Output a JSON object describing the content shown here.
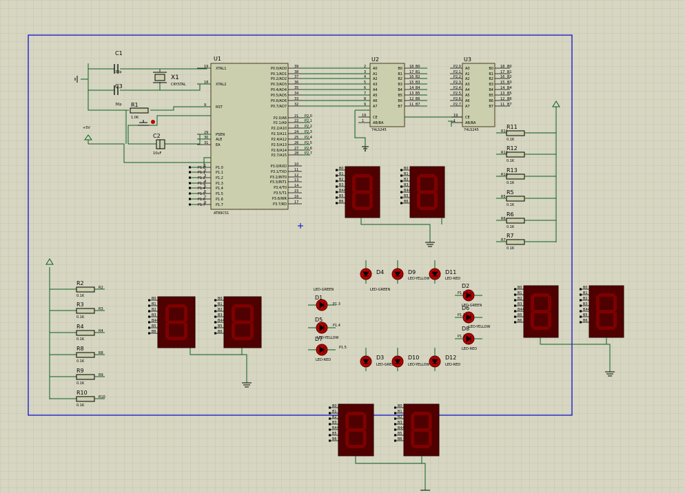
{
  "schematic": {
    "u1": {
      "ref": "U1",
      "part": "AT89C51",
      "left_pins": [
        {
          "num": "19",
          "name": "XTAL1"
        },
        {
          "num": "18",
          "name": "XTAL2"
        },
        {
          "num": "9",
          "name": "RST"
        },
        {
          "num": "29",
          "name": "PSEN"
        },
        {
          "num": "30",
          "name": "ALE"
        },
        {
          "num": "31",
          "name": "EA"
        },
        {
          "num": "1",
          "name": "P1.0"
        },
        {
          "num": "2",
          "name": "P1.1"
        },
        {
          "num": "3",
          "name": "P1.2"
        },
        {
          "num": "4",
          "name": "P1.3"
        },
        {
          "num": "5",
          "name": "P1.4"
        },
        {
          "num": "6",
          "name": "P1.5"
        },
        {
          "num": "7",
          "name": "P1.6"
        },
        {
          "num": "8",
          "name": "P1.7"
        }
      ],
      "right_pins": [
        {
          "num": "39",
          "name": "P0.0/AD0"
        },
        {
          "num": "38",
          "name": "P0.1/AD1"
        },
        {
          "num": "37",
          "name": "P0.2/AD2"
        },
        {
          "num": "36",
          "name": "P0.3/AD3"
        },
        {
          "num": "35",
          "name": "P0.4/AD4"
        },
        {
          "num": "34",
          "name": "P0.5/AD5"
        },
        {
          "num": "33",
          "name": "P0.6/AD6"
        },
        {
          "num": "32",
          "name": "P0.7/AD7"
        },
        {
          "num": "21",
          "name": "P2.0/A8"
        },
        {
          "num": "22",
          "name": "P2.1/A9"
        },
        {
          "num": "23",
          "name": "P2.2/A10"
        },
        {
          "num": "24",
          "name": "P2.3/A11"
        },
        {
          "num": "25",
          "name": "P2.4/A12"
        },
        {
          "num": "26",
          "name": "P2.5/A13"
        },
        {
          "num": "27",
          "name": "P2.6/A14"
        },
        {
          "num": "28",
          "name": "P2.7/A15"
        },
        {
          "num": "10",
          "name": "P3.0/RXD"
        },
        {
          "num": "11",
          "name": "P3.1/TXD"
        },
        {
          "num": "12",
          "name": "P3.2/INT0"
        },
        {
          "num": "13",
          "name": "P3.3/INT1"
        },
        {
          "num": "14",
          "name": "P3.4/T0"
        },
        {
          "num": "15",
          "name": "P3.5/T1"
        },
        {
          "num": "16",
          "name": "P3.6/WR"
        },
        {
          "num": "17",
          "name": "P3.7/RD"
        }
      ]
    },
    "u2": {
      "ref": "U2",
      "part": "74LS245",
      "a_pins": [
        {
          "num": "2",
          "name": "A0"
        },
        {
          "num": "3",
          "name": "A1"
        },
        {
          "num": "4",
          "name": "A2"
        },
        {
          "num": "5",
          "name": "A3"
        },
        {
          "num": "6",
          "name": "A4"
        },
        {
          "num": "7",
          "name": "A5"
        },
        {
          "num": "8",
          "name": "A6"
        },
        {
          "num": "9",
          "name": "A7"
        }
      ],
      "b_pins": [
        {
          "num": "18",
          "name": "B0"
        },
        {
          "num": "17",
          "name": "B1"
        },
        {
          "num": "16",
          "name": "B2"
        },
        {
          "num": "15",
          "name": "B3"
        },
        {
          "num": "14",
          "name": "B4"
        },
        {
          "num": "13",
          "name": "B5"
        },
        {
          "num": "12",
          "name": "B6"
        },
        {
          "num": "11",
          "name": "B7"
        }
      ],
      "ctrl_pins": [
        {
          "num": "19",
          "name": "CE"
        },
        {
          "num": "1",
          "name": "AB/BA"
        }
      ]
    },
    "u3": {
      "ref": "U3",
      "part": "74LS245"
    },
    "crystal": {
      "ref": "X1",
      "part": "CRYSTAL"
    },
    "capacitors": [
      {
        "ref": "C1",
        "value": "30p"
      },
      {
        "ref": "C3",
        "value": "30p"
      },
      {
        "ref": "C2",
        "value": "10uF"
      }
    ],
    "reset_res": {
      "ref": "R1",
      "value": "1.0K"
    },
    "vcc_label": "+5V",
    "resistor_value": "0.1K",
    "resistors_right": [
      "R11",
      "R12",
      "R13",
      "R5",
      "R6",
      "R7"
    ],
    "resistors_left": [
      "R2",
      "R3",
      "R4",
      "R8",
      "R9",
      "R10"
    ],
    "leds": [
      {
        "ref": "D4",
        "label": "LED-GREEN"
      },
      {
        "ref": "D9",
        "label": "LED-YELLOW"
      },
      {
        "ref": "D11",
        "label": "LED-RED"
      },
      {
        "ref": "D1",
        "label": "LED-GREEN"
      },
      {
        "ref": "D5",
        "label": "LED-YELLOW"
      },
      {
        "ref": "D7",
        "label": "LED-RED"
      },
      {
        "ref": "D2",
        "label": "LED-GREEN"
      },
      {
        "ref": "D6",
        "label": "LED-YELLOW"
      },
      {
        "ref": "D8",
        "label": "LED-RED"
      },
      {
        "ref": "D3",
        "label": "LED-GREEN"
      },
      {
        "ref": "D10",
        "label": "LED-YELLOW"
      },
      {
        "ref": "D12",
        "label": "LED-RED"
      }
    ],
    "seg_pins": [
      "B0",
      "B1",
      "B2",
      "B3",
      "B44",
      "B5",
      "B6"
    ],
    "net_labels": [
      "P1.3",
      "P1.4",
      "P1.5",
      "P1.0",
      "P1.1",
      "P1.2"
    ],
    "colors": {
      "background": "#d6d6c2",
      "grid": "#c3c3ad",
      "border": "#0000cc",
      "wire": "#0b5d1e",
      "chip": "#cbcfae",
      "display": "#4f0000",
      "segment": "#7f0000",
      "led": "#b20000",
      "ink": "#000000"
    }
  }
}
